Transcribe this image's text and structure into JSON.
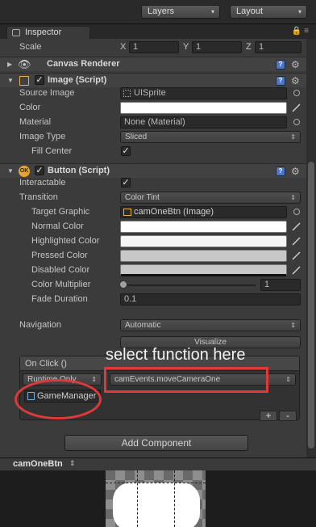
{
  "toolbar": {
    "layers": "Layers",
    "layout": "Layout"
  },
  "tab": {
    "title": "Inspector"
  },
  "scale": {
    "label": "Scale",
    "x_label": "X",
    "x": "1",
    "y_label": "Y",
    "y": "1",
    "z_label": "Z",
    "z": "1"
  },
  "canvas_renderer": {
    "title": "Canvas Renderer"
  },
  "image": {
    "title": "Image (Script)",
    "source_image_label": "Source Image",
    "source_image": "UISprite",
    "color_label": "Color",
    "material_label": "Material",
    "material": "None (Material)",
    "image_type_label": "Image Type",
    "image_type": "Sliced",
    "fill_center_label": "Fill Center"
  },
  "button": {
    "title": "Button (Script)",
    "interactable_label": "Interactable",
    "transition_label": "Transition",
    "transition": "Color Tint",
    "target_graphic_label": "Target Graphic",
    "target_graphic": "camOneBtn (Image)",
    "normal_label": "Normal Color",
    "highlighted_label": "Highlighted Color",
    "pressed_label": "Pressed Color",
    "disabled_label": "Disabled Color",
    "multiplier_label": "Color Multiplier",
    "multiplier": "1",
    "fade_label": "Fade Duration",
    "fade": "0.1",
    "navigation_label": "Navigation",
    "navigation": "Automatic",
    "visualize": "Visualize"
  },
  "onclick": {
    "title": "On Click ()",
    "runtime": "Runtime Only",
    "function": "camEvents.moveCameraOne",
    "object": "GameManager",
    "plus": "+",
    "minus": "-"
  },
  "add_component": "Add Component",
  "annotation": {
    "text": "select function here",
    "color": "#e0393a"
  },
  "preview": {
    "title": "camOneBtn"
  },
  "colors": {
    "panel": "#3b3b3b",
    "field": "#2a2a2a",
    "accent": "#4a78c4"
  }
}
